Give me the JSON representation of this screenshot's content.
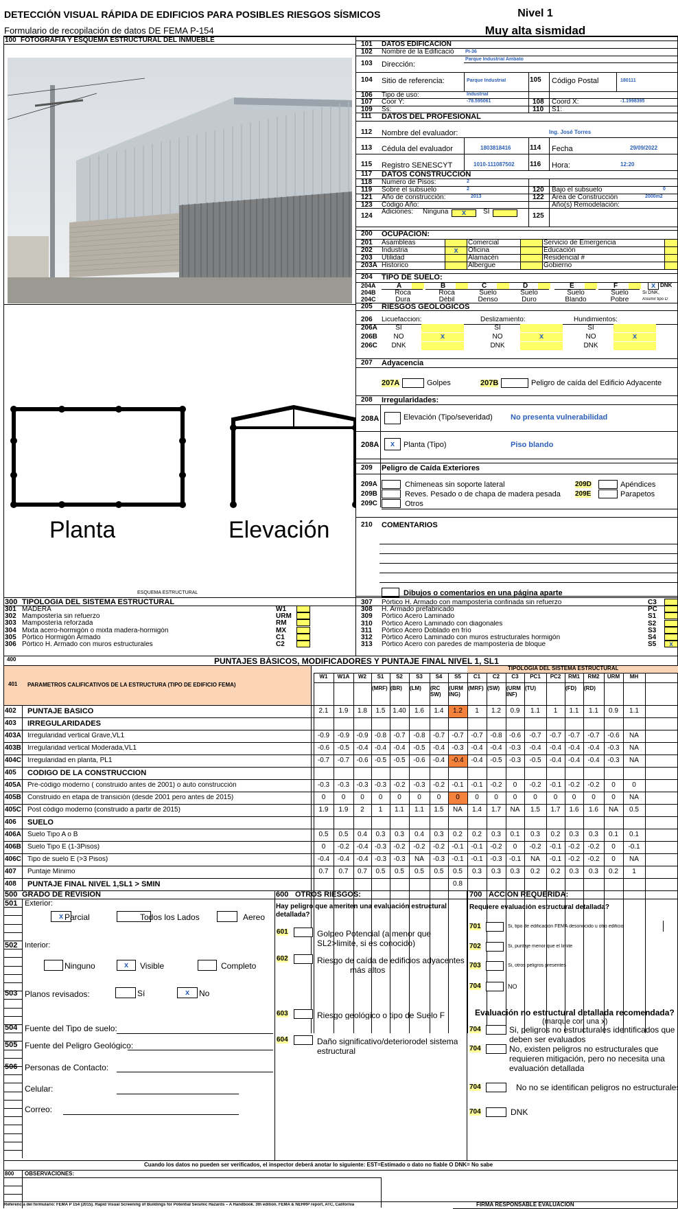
{
  "header": {
    "title": "DETECCIÓN VISUAL RÁPIDA DE EDIFICIOS PARA POSIBLES RIESGOS SÍSMICOS",
    "subtitle": "Formulario de recopilación de datos DE FEMA P-154",
    "level": "Nivel 1",
    "seismicity": "Muy alta sismidad"
  },
  "photo": {
    "num": "100",
    "label": "FOTOGRAFÍA Y ESQUEMA ESTRUCTURAL DEL INMUEBLE"
  },
  "sketch": {
    "plan_label": "Planta",
    "elev_label": "Elevación",
    "caption": "ESQUEMA ESTRUCTURAL"
  },
  "building": {
    "head": [
      "101",
      "DATOS EDIFICACIÓN"
    ],
    "r102": [
      "102",
      "Nombre de la Edificació",
      "PI-36"
    ],
    "r103": [
      "103",
      "Dirección:",
      "Parque Industrial Ambato"
    ],
    "r104": [
      "104",
      "Sitio de referencia:",
      "Parque Industrial",
      "105",
      "Código Postal",
      "180111"
    ],
    "r106": [
      "106",
      "Tipo de uso:",
      "Industrial"
    ],
    "r107": [
      "107",
      "Coor Y:",
      "-78.595061",
      "108",
      "Coord X:",
      "-1.1998395"
    ],
    "r109": [
      "109",
      "Ss:",
      "110",
      "S1:"
    ]
  },
  "prof": {
    "head": [
      "111",
      "DATOS DEL PROFESIONAL"
    ],
    "r112": [
      "112",
      "Nombre del evaluador:",
      "Ing. José Torres"
    ],
    "r113": [
      "113",
      "Cédula del evaluador",
      "1803818416",
      "114",
      "Fecha",
      "29/09/2022"
    ],
    "r115": [
      "115",
      "Registro SENESCYT",
      "1010-111087502",
      "116",
      "Hora:",
      "12:20"
    ]
  },
  "constr": {
    "head": [
      "117",
      "DATOS CONSTRUCCIÓN"
    ],
    "r118": [
      "118",
      "Numero de Pisos:",
      "2"
    ],
    "r119": [
      "119",
      "Sobre el subsuelo",
      "2",
      "120",
      "Bajo el subsuelo",
      "0"
    ],
    "r121": [
      "121",
      "Año de construcción:",
      "2013",
      "122",
      "Area de Construcción",
      "2000m2"
    ],
    "r123": [
      "123",
      "Código Año:",
      "Año(s) Remodelación:"
    ],
    "r124": [
      "124",
      "Adiciones:",
      "Ninguna",
      "x",
      "SI",
      "125"
    ]
  },
  "occup": {
    "head": [
      "200",
      "OCUPACIÓN:"
    ],
    "rows": [
      [
        "201",
        "Asambleas",
        "",
        "Comercial",
        "",
        "Servicio de  Emergencia",
        ""
      ],
      [
        "202",
        "Industria",
        "x",
        "Oficina",
        "",
        "Educación",
        ""
      ],
      [
        "203",
        "Utilidad",
        "",
        "Alamacén",
        "",
        "Residencial #",
        ""
      ],
      [
        "203A",
        "Historico",
        "",
        "Albergue",
        "",
        "Gobierno",
        ""
      ]
    ]
  },
  "soil": {
    "head": [
      "204",
      "TIPO DE SUELO:"
    ],
    "codes": [
      "204A",
      "204B",
      "204C"
    ],
    "letters": [
      "A",
      "B",
      "C",
      "D",
      "E",
      "F"
    ],
    "names": [
      [
        "Roca",
        "Dura"
      ],
      [
        "Roca",
        "Débil"
      ],
      [
        "Suelo",
        "Denso"
      ],
      [
        "Suelo",
        "Duro"
      ],
      [
        "Suelo",
        "Blando"
      ],
      [
        "Suelo",
        "Pobre"
      ]
    ],
    "dnk": "DNK",
    "mark": "x",
    "dnk_note1": "Si DNK,",
    "dnk_note2": "ASumir tipo D"
  },
  "geo": {
    "head": [
      "205",
      "RIESGOS GEOLOGICOS"
    ],
    "r206": [
      "206",
      "Licuefaccion:",
      "Deslizamiento:",
      "Hundimientos:"
    ],
    "codes": [
      "206A",
      "206B",
      "206C"
    ],
    "opts": [
      "SI",
      "NO",
      "DNK"
    ],
    "mark": "x"
  },
  "adj": {
    "head": [
      "207",
      "Adyacencia"
    ],
    "a": [
      "207A",
      "Golpes"
    ],
    "b": [
      "207B",
      "Peligro de caída del Edificio Adyacente"
    ]
  },
  "irreg": {
    "head": [
      "208",
      "Irregularidades:"
    ],
    "r1": [
      "208A",
      "Elevación (Tipo/severidad)",
      "No presenta vulnerabilidad"
    ],
    "r2": [
      "208A",
      "x",
      "Planta (Tipo)",
      "Piso blando"
    ]
  },
  "ext": {
    "head": [
      "209",
      "Peligro de Caída Exteriores"
    ],
    "a": [
      "209A",
      "Chimeneas sin soporte lateral",
      "209D",
      "Apéndices"
    ],
    "b": [
      "209B",
      "Reves. Pesado o de chapa de madera pesada",
      "209E",
      "Parapetos"
    ],
    "c": [
      "209C",
      "Otros"
    ]
  },
  "comments": {
    "head": [
      "210",
      "COMENTARIOS"
    ],
    "footer": "Dibujos o comentarios en una página aparte"
  },
  "typology": {
    "head": [
      "300",
      "TIPOLOGIA DEL SISTEMA ESTRUCTURAL"
    ],
    "left": [
      [
        "301",
        "MADERA",
        "W1"
      ],
      [
        "302",
        "Mampostería sin refuerzo",
        "URM"
      ],
      [
        "303",
        "Mampostería reforzada",
        "RM"
      ],
      [
        "304",
        "Mixta acero-hormigón o mixta madera-hormigón",
        "MX"
      ],
      [
        "305",
        "Pórtico Hormigón Armado",
        "C1"
      ],
      [
        "306",
        "Pórtico H. Armado con muros estructurales",
        "C2"
      ]
    ],
    "right": [
      [
        "307",
        "Pórtico H. Armado con mampostería confinada sin refuerzo",
        "C3",
        ""
      ],
      [
        "308",
        "H. Armado prefabricado",
        "PC",
        ""
      ],
      [
        "309",
        "Pórtico Acero Laminado",
        "S1",
        ""
      ],
      [
        "310",
        "Pórtico Acero Laminado con diagonales",
        "S2",
        ""
      ],
      [
        "311",
        "Pórtico Acero Doblado en frío",
        "S3",
        ""
      ],
      [
        "312",
        "Pórtico Acero Laminado con muros estructurales hormigón",
        "S4",
        ""
      ],
      [
        "313",
        "Pórtico Acero con paredes de mampostería de bloque",
        "S5",
        "x"
      ]
    ]
  },
  "scores": {
    "title_num": "400",
    "title": "PUNTAJES BÁSICOS, MODIFICADORES Y PUNTAJE FINAL NIVEL 1,  SL1",
    "param_num": "401",
    "param_label": "PARÁMETROS CALIFICATIVOS DE LA ESTRUCTURA (TIPO DE EDIFICIO FEMA)",
    "group_label": "TIPOLOGIA DEL SISTEMA ESTRUCTURAL",
    "cols": [
      "W1",
      "W1A",
      "W2",
      "S1",
      "S2",
      "S3",
      "S4",
      "S5",
      "C1",
      "C2",
      "C3",
      "PC1",
      "PC2",
      "RM1",
      "RM2",
      "URM",
      "MH"
    ],
    "subs": [
      "",
      "",
      "",
      "(MRF)",
      "(BR)",
      "(LM)",
      "(RC SW)",
      "(URM ING)",
      "(MRF)",
      "(SW)",
      "(URM INF)",
      "(TU)",
      "",
      "(FD)",
      "(RD)",
      "",
      ""
    ],
    "rows": [
      {
        "num": "402",
        "label": "PUNTAJE BÁSICO",
        "bold": true,
        "vals": [
          "2.1",
          "1.9",
          "1.8",
          "1.5",
          "1.40",
          "1.6",
          "1.4",
          "1.2",
          "1",
          "1.2",
          "0.9",
          "1.1",
          "1",
          "1.1",
          "1.1",
          "0.9",
          "1.1"
        ]
      },
      {
        "num": "403",
        "label": "IRREGULARIDADES",
        "section": true
      },
      {
        "num": "403A",
        "label": "Irregularidad vertical Grave,VL1",
        "vals": [
          "-0.9",
          "-0.9",
          "-0.9",
          "-0.8",
          "-0.7",
          "-0.8",
          "-0.7",
          "-0.7",
          "-0.7",
          "-0.8",
          "-0.6",
          "-0.7",
          "-0.7",
          "-0.7",
          "-0.7",
          "-0.6",
          "NA"
        ]
      },
      {
        "num": "403B",
        "label": "Irregularidad vertical Moderada,VL1",
        "vals": [
          "-0.6",
          "-0.5",
          "-0.4",
          "-0.4",
          "-0.4",
          "-0.5",
          "-0.4",
          "-0.3",
          "-0.4",
          "-0.4",
          "-0.3",
          "-0.4",
          "-0.4",
          "-0.4",
          "-0.4",
          "-0.3",
          "NA"
        ]
      },
      {
        "num": "404C",
        "label": "Irregularidad en planta, PL1",
        "vals": [
          "-0.7",
          "-0.7",
          "-0.6",
          "-0.5",
          "-0.5",
          "-0.6",
          "-0.4",
          "-0.4",
          "-0.4",
          "-0.5",
          "-0.3",
          "-0.5",
          "-0.4",
          "-0.4",
          "-0.4",
          "-0.3",
          "NA"
        ]
      },
      {
        "num": "405",
        "label": "CODIGO DE LA CONSTRUCCIÓN",
        "section": true
      },
      {
        "num": "405A",
        "label": "Pre-código moderno ( construido antes de 2001) o auto construcción",
        "vals": [
          "-0.3",
          "-0.3",
          "-0.3",
          "-0.3",
          "-0.2",
          "-0.3",
          "-0.2",
          "-0.1",
          "-0.1",
          "-0.2",
          "0",
          "-0.2",
          "-0.1",
          "-0.2",
          "-0.2",
          "0",
          "0"
        ]
      },
      {
        "num": "405B",
        "label": "Construido en etapa de transición (desde 2001 pero antes de 2015)",
        "vals": [
          "0",
          "0",
          "0",
          "0",
          "0",
          "0",
          "0",
          "0",
          "0",
          "0",
          "0",
          "0",
          "0",
          "0",
          "0",
          "0",
          "NA"
        ]
      },
      {
        "num": "405C",
        "label": "Post código moderno (construido a partir de 2015)",
        "vals": [
          "1.9",
          "1.9",
          "2",
          "1",
          "1.1",
          "1.1",
          "1.5",
          "NA",
          "1.4",
          "1.7",
          "NA",
          "1.5",
          "1.7",
          "1.6",
          "1.6",
          "NA",
          "0.5"
        ]
      },
      {
        "num": "406",
        "label": "SUELO",
        "section": true
      },
      {
        "num": "406A",
        "label": "Suelo Tipo A o B",
        "vals": [
          "0.5",
          "0.5",
          "0.4",
          "0.3",
          "0.3",
          "0.4",
          "0.3",
          "0.2",
          "0.2",
          "0.3",
          "0.1",
          "0.3",
          "0.2",
          "0.3",
          "0.3",
          "0.1",
          "0.1"
        ]
      },
      {
        "num": "406B",
        "label": "Suelo Tipo E (1-3Pisos)",
        "vals": [
          "0",
          "-0.2",
          "-0.4",
          "-0.3",
          "-0.2",
          "-0.2",
          "-0.2",
          "-0.1",
          "-0.1",
          "-0.2",
          "0",
          "-0.2",
          "-0.1",
          "-0.2",
          "-0.2",
          "0",
          "-0.1"
        ]
      },
      {
        "num": "406C",
        "label": "Tipo de suelo E (>3 Pisos)",
        "vals": [
          "-0.4",
          "-0.4",
          "-0.4",
          "-0.3",
          "-0.3",
          "NA",
          "-0.3",
          "-0.1",
          "-0.1",
          "-0.3",
          "-0.1",
          "NA",
          "-0.1",
          "-0.2",
          "-0.2",
          "0",
          "NA"
        ]
      },
      {
        "num": "407",
        "label": "Puntaje Mínimo",
        "vals": [
          "0.7",
          "0.7",
          "0.7",
          "0.5",
          "0.5",
          "0.5",
          "0.5",
          "0.5",
          "0.3",
          "0.3",
          "0.3",
          "0.2",
          "0.2",
          "0.3",
          "0.3",
          "0.2",
          "1"
        ]
      },
      {
        "num": "408",
        "label": "PUNTAJE FINAL NIVEL 1,SL1 > SMIN",
        "bold": true,
        "vals": [
          "",
          "",
          "",
          "",
          "",
          "",
          "",
          "0.8",
          "",
          "",
          "",
          "",
          "",
          "",
          "",
          "",
          ""
        ]
      }
    ],
    "highlight_color": "#f4823c"
  },
  "review": {
    "head": [
      "500",
      "GRADO DE REVISIÓN"
    ],
    "r501": [
      "501",
      "Exterior:"
    ],
    "ext_opts": [
      [
        "x",
        "Parcial"
      ],
      [
        "",
        "Todos los Lados"
      ],
      [
        "",
        "Aereo"
      ]
    ],
    "r502": [
      "502",
      "Interior:"
    ],
    "int_opts": [
      [
        "",
        "Ninguno"
      ],
      [
        "x",
        "Visible"
      ],
      [
        "",
        "Completo"
      ]
    ],
    "r503": [
      "503",
      "Planos revisados:",
      "",
      "Sí",
      "x",
      "No"
    ],
    "r504": [
      "504",
      "Fuente del Tipo de suelo:"
    ],
    "r505": [
      "505",
      "Fuente del Peligro Geológico:"
    ],
    "r506": [
      "506",
      "Personas de Contacto:"
    ],
    "cel": "Celular:",
    "mail": "Correo:"
  },
  "other": {
    "head": [
      "600",
      "OTROS RIESGOS:"
    ],
    "q": "Hay peligro que ameriten una evaluación estructural detallada?",
    "i601": [
      "601",
      "Golpeo Potencial (a menor que",
      "SL2>limite, si es conocido)"
    ],
    "i602": [
      "602",
      "Riesgo de caída de edificios adyacentes",
      "más altos"
    ],
    "i603": [
      "603",
      "Riesgo geológico o tipo de Suelo F"
    ],
    "i604": [
      "604",
      "Daño significativo/deteriorodel sistema",
      "estructural"
    ]
  },
  "action": {
    "head": [
      "700",
      "ACCIÓN REQUERIDA:"
    ],
    "q": "Requiere evaluación estructural detallada?",
    "i701": [
      "701",
      "Si, tipo de edificación FEMA desonocido u otro edificio"
    ],
    "i702": [
      "702",
      "Si, puntaje menor que el limite"
    ],
    "i703": [
      "703",
      "Si, otros peligros presentes"
    ],
    "i704": [
      "704",
      "NO"
    ],
    "q2": "Evaluación no estructural detallada recomendada?",
    "q2sub": "(marque con una x)",
    "n1": [
      "704",
      "Si, peligros no estructurales identificados que",
      "deben ser evaluados"
    ],
    "n2": [
      "704",
      "No, existen peligros no estructurales que",
      "requieren mitigación, pero no necesita una",
      "evaluación detallada"
    ],
    "n3": [
      "704",
      "No no se identifican peligros no estructurales"
    ],
    "n4": [
      "704",
      "DNK"
    ]
  },
  "footnote": "Cuando los datos no pueden ser verificados, el inspector deberá anotar lo siguiente: EST=Estimado o dato no fiable O DNK= No sabe",
  "obs": {
    "head": [
      "800",
      "OBSERVACIONES:"
    ]
  },
  "signature": "FIRMA  RESPONSABLE EVALUACION",
  "reference": "Referencia del formulario: FEMA P 154 (2015). Rapid Visual Screening of Buildings for Potential Seismic Hazards – A Handbook. 3th edition. FEMA & NEHRP report, ATC, California"
}
